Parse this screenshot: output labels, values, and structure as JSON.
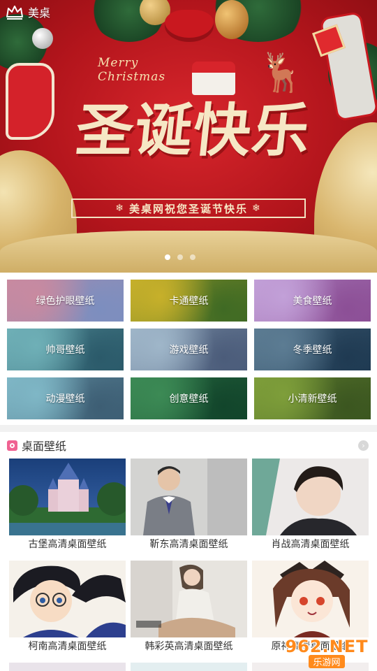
{
  "topbar": {
    "label": "美桌",
    "icon": "crown-home-icon"
  },
  "banner": {
    "script_text": "Merry Christmas",
    "title": "圣诞快乐",
    "subtitle": "美桌网祝您圣诞节快乐",
    "snowflake": "❄",
    "dots": [
      true,
      false,
      false
    ],
    "colors": {
      "background": "#b3151c",
      "text": "#f6e7c5",
      "gold": "#d7b46b"
    }
  },
  "categories": [
    {
      "label": "绿色护眼壁纸",
      "color_a": "#c98aa0",
      "color_b": "#7c8ebf"
    },
    {
      "label": "卡通壁纸",
      "color_a": "#c7b02a",
      "color_b": "#3f6a24"
    },
    {
      "label": "美食壁纸",
      "color_a": "#c2a0d8",
      "color_b": "#8c4f96"
    },
    {
      "label": "帅哥壁纸",
      "color_a": "#6fb0b7",
      "color_b": "#2b5a6a"
    },
    {
      "label": "游戏壁纸",
      "color_a": "#9fb6c9",
      "color_b": "#4b5c7a"
    },
    {
      "label": "冬季壁纸",
      "color_a": "#5c7c93",
      "color_b": "#1f3a52"
    },
    {
      "label": "动漫壁纸",
      "color_a": "#7fb7c6",
      "color_b": "#3d5e74"
    },
    {
      "label": "创意壁纸",
      "color_a": "#3c8a55",
      "color_b": "#12452b"
    },
    {
      "label": "小清新壁纸",
      "color_a": "#7e9e3a",
      "color_b": "#3b5620"
    }
  ],
  "section": {
    "title": "桌面壁纸",
    "icon": "wallpaper-section-icon",
    "more_icon": "chevron-right-icon",
    "items": [
      {
        "caption": "古堡高清桌面壁纸",
        "bg_a": "#1d4f8e",
        "bg_b": "#2f7a3a",
        "accent": "#e8c9d4"
      },
      {
        "caption": "靳东高清桌面壁纸",
        "bg_a": "#d8d8d6",
        "bg_b": "#9a9ba0",
        "accent": "#6f7378"
      },
      {
        "caption": "肖战高清桌面壁纸",
        "bg_a": "#e7e4e4",
        "bg_b": "#bfe0d8",
        "accent": "#2b2520"
      },
      {
        "caption": "柯南高清桌面壁纸",
        "bg_a": "#f6f2ec",
        "bg_b": "#3a4a93",
        "accent": "#222"
      },
      {
        "caption": "韩彩英高清桌面壁纸",
        "bg_a": "#e3e0dc",
        "bg_b": "#bdb7b0",
        "accent": "#8a7b6c"
      },
      {
        "caption": "原神高清桌面壁纸",
        "bg_a": "#f7efe8",
        "bg_b": "#e6d6c8",
        "accent": "#6b3b2a"
      }
    ]
  },
  "watermark": {
    "brand_number": "962.NET",
    "brand_sub": "乐游网"
  }
}
